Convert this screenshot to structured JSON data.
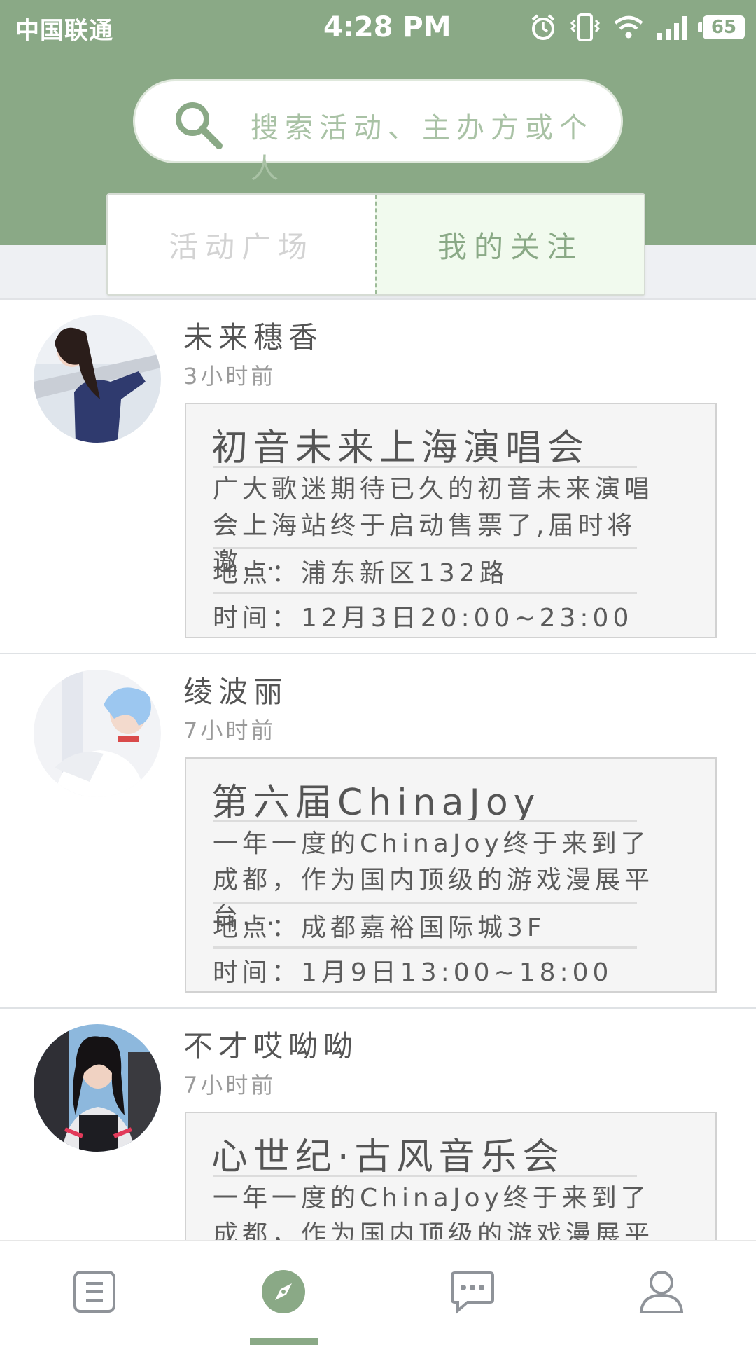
{
  "status_bar": {
    "carrier": "中国联通",
    "time": "4:28 PM",
    "battery": "65",
    "icons": [
      "alarm-icon",
      "vibrate-icon",
      "wifi-icon",
      "signal-icon",
      "battery-icon"
    ]
  },
  "search": {
    "placeholder": "搜索活动、主办方或个人",
    "icon": "search-icon"
  },
  "tabs": [
    {
      "label": "活动广场",
      "active": false
    },
    {
      "label": "我的关注",
      "active": true
    }
  ],
  "feed": [
    {
      "user": "未来穗香",
      "time": "3小时前",
      "event": {
        "title": "初音未来上海演唱会",
        "description": "广大歌迷期待已久的初音未来演唱会上海站终于启动售票了,届时将邀...",
        "place": "地点：浦东新区132路",
        "time": "时间：12月3日20:00~23:00"
      }
    },
    {
      "user": "绫波丽",
      "time": "7小时前",
      "event": {
        "title": "第六届ChinaJoy",
        "description": "一年一度的ChinaJoy终于来到了成都，作为国内顶级的游戏漫展平台...",
        "place": "地点：成都嘉裕国际城3F",
        "time": "时间：1月9日13:00~18:00"
      }
    },
    {
      "user": "不才哎呦呦",
      "time": "7小时前",
      "event": {
        "title": "心世纪·古风音乐会",
        "description": "一年一度的ChinaJoy终于来到了成都，作为国内顶级的游戏漫展平台...",
        "place": "",
        "time": ""
      }
    }
  ],
  "bottom_nav": [
    {
      "icon": "list-icon",
      "active": false
    },
    {
      "icon": "compass-icon",
      "active": true
    },
    {
      "icon": "message-icon",
      "active": false
    },
    {
      "icon": "profile-icon",
      "active": false
    }
  ],
  "colors": {
    "accent": "#8aa986",
    "tab_active_bg": "#f1faee",
    "card_bg": "#f5f5f5",
    "nav_icon": "#8f9399"
  }
}
